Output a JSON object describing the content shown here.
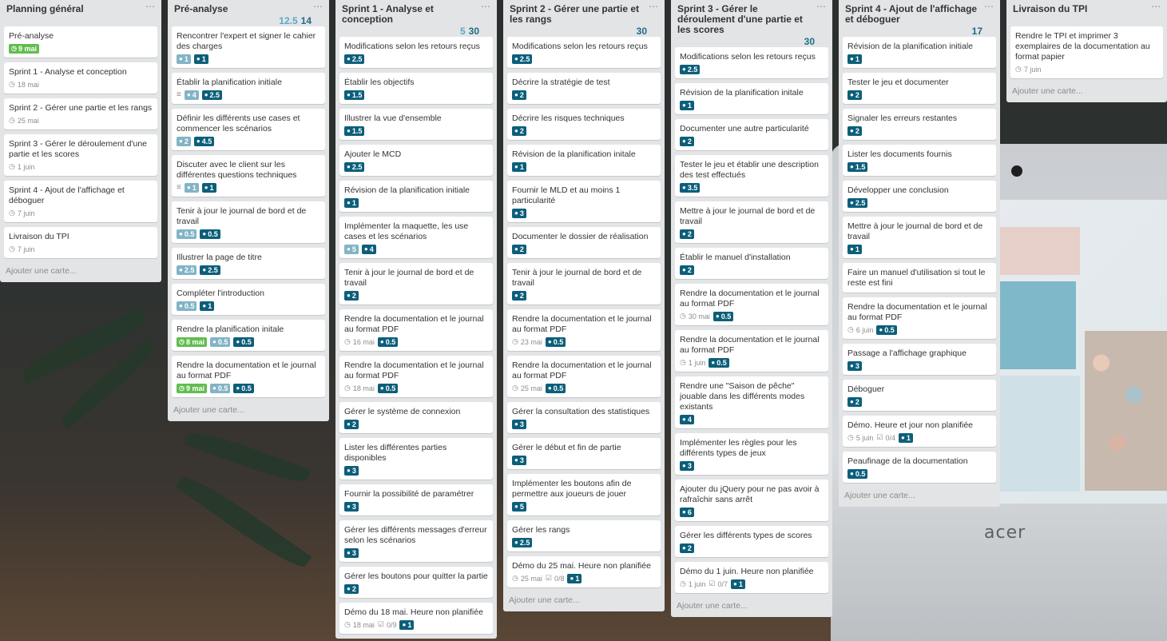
{
  "lists": [
    {
      "title": "Planning général",
      "points_a": "",
      "points_b": "",
      "add_card": "Ajouter une carte...",
      "cards": [
        {
          "title": "Pré-analyse",
          "date": "9 mai",
          "date_done": true,
          "badges": []
        },
        {
          "title": "Sprint 1 - Analyse et conception",
          "date": "18 mai",
          "badges": []
        },
        {
          "title": "Sprint 2 - Gérer une partie et les rangs",
          "date": "25 mai",
          "badges": []
        },
        {
          "title": "Sprint 3 - Gérer le déroulement d'une partie et les scores",
          "date": "1 juin",
          "badges": []
        },
        {
          "title": "Sprint 4 - Ajout de l'affichage et déboguer",
          "date": "7 juin",
          "badges": []
        },
        {
          "title": "Livraison du TPI",
          "date": "7 juin",
          "badges": []
        }
      ]
    },
    {
      "title": "Pré-analyse",
      "points_a": "12.5",
      "points_b": "14",
      "add_card": "Ajouter une carte...",
      "cards": [
        {
          "title": "Rencontrer l'expert et signer le cahier des charges",
          "badges": [
            {
              "t": "light",
              "v": "1"
            },
            {
              "t": "dark",
              "v": "1"
            }
          ]
        },
        {
          "title": "Établir la planification initiale",
          "desc": true,
          "badges": [
            {
              "t": "light",
              "v": "4"
            },
            {
              "t": "dark",
              "v": "2.5"
            }
          ]
        },
        {
          "title": "Définir les différents use cases et commencer les scénarios",
          "badges": [
            {
              "t": "light",
              "v": "2"
            },
            {
              "t": "dark",
              "v": "4.5"
            }
          ]
        },
        {
          "title": "Discuter avec le client sur les différentes questions techniques",
          "desc": true,
          "badges": [
            {
              "t": "light",
              "v": "1"
            },
            {
              "t": "dark",
              "v": "1"
            }
          ]
        },
        {
          "title": "Tenir à jour le journal de bord et de travail",
          "badges": [
            {
              "t": "light",
              "v": "0.5"
            },
            {
              "t": "dark",
              "v": "0.5"
            }
          ]
        },
        {
          "title": "Illustrer la page de titre",
          "badges": [
            {
              "t": "light",
              "v": "2.5"
            },
            {
              "t": "dark",
              "v": "2.5"
            }
          ]
        },
        {
          "title": "Compléter l'introduction",
          "badges": [
            {
              "t": "light",
              "v": "0.5"
            },
            {
              "t": "dark",
              "v": "1"
            }
          ]
        },
        {
          "title": "Rendre la planification initale",
          "date": "8 mai",
          "date_done": true,
          "badges": [
            {
              "t": "light",
              "v": "0.5"
            },
            {
              "t": "dark",
              "v": "0.5"
            }
          ]
        },
        {
          "title": "Rendre la documentation et le journal au format PDF",
          "date": "9 mai",
          "date_done": true,
          "badges": [
            {
              "t": "light",
              "v": "0.5"
            },
            {
              "t": "dark",
              "v": "0.5"
            }
          ]
        }
      ]
    },
    {
      "title": "Sprint 1 - Analyse et conception",
      "points_a": "5",
      "points_b": "30",
      "add_card": "",
      "cards": [
        {
          "title": "Modifications selon les retours reçus",
          "badges": [
            {
              "t": "dark",
              "v": "2.5"
            }
          ]
        },
        {
          "title": "Établir les objectifs",
          "badges": [
            {
              "t": "dark",
              "v": "1.5"
            }
          ]
        },
        {
          "title": "Illustrer la vue d'ensemble",
          "badges": [
            {
              "t": "dark",
              "v": "1.5"
            }
          ]
        },
        {
          "title": "Ajouter le MCD",
          "badges": [
            {
              "t": "dark",
              "v": "2.5"
            }
          ]
        },
        {
          "title": "Révision de la planification initiale",
          "badges": [
            {
              "t": "dark",
              "v": "1"
            }
          ]
        },
        {
          "title": "Implémenter la maquette, les use cases et les scénarios",
          "badges": [
            {
              "t": "light",
              "v": "5"
            },
            {
              "t": "dark",
              "v": "4"
            }
          ]
        },
        {
          "title": "Tenir à jour le journal de bord et de travail",
          "badges": [
            {
              "t": "dark",
              "v": "2"
            }
          ]
        },
        {
          "title": "Rendre la documentation et le journal au format PDF",
          "date": "16 mai",
          "badges": [
            {
              "t": "dark",
              "v": "0.5"
            }
          ]
        },
        {
          "title": "Rendre la documentation et le journal au format PDF",
          "date": "18 mai",
          "badges": [
            {
              "t": "dark",
              "v": "0.5"
            }
          ]
        },
        {
          "title": "Gérer le système de connexion",
          "badges": [
            {
              "t": "dark",
              "v": "2"
            }
          ]
        },
        {
          "title": "Lister les différentes parties disponibles",
          "badges": [
            {
              "t": "dark",
              "v": "3"
            }
          ]
        },
        {
          "title": "Fournir la possibilité de paramétrer",
          "badges": [
            {
              "t": "dark",
              "v": "3"
            }
          ]
        },
        {
          "title": "Gérer les différents messages d'erreur selon les scénarios",
          "badges": [
            {
              "t": "dark",
              "v": "3"
            }
          ]
        },
        {
          "title": "Gérer les boutons pour quitter la partie",
          "badges": [
            {
              "t": "dark",
              "v": "2"
            }
          ]
        },
        {
          "title": "Démo du 18 mai. Heure non planifiée",
          "date": "18 mai",
          "checklist": "0/9",
          "badges": [
            {
              "t": "dark",
              "v": "1"
            }
          ]
        }
      ]
    },
    {
      "title": "Sprint 2 - Gérer une partie et les rangs",
      "points_a": "",
      "points_b": "30",
      "add_card": "Ajouter une carte...",
      "cards": [
        {
          "title": "Modifications selon les retours reçus",
          "badges": [
            {
              "t": "dark",
              "v": "2.5"
            }
          ]
        },
        {
          "title": "Décrire la stratégie de test",
          "badges": [
            {
              "t": "dark",
              "v": "2"
            }
          ]
        },
        {
          "title": "Décrire les risques techniques",
          "badges": [
            {
              "t": "dark",
              "v": "2"
            }
          ]
        },
        {
          "title": "Révision de la planification initale",
          "badges": [
            {
              "t": "dark",
              "v": "1"
            }
          ]
        },
        {
          "title": "Fournir le MLD et au moins 1 particularité",
          "badges": [
            {
              "t": "dark",
              "v": "3"
            }
          ]
        },
        {
          "title": "Documenter le dossier de réalisation",
          "badges": [
            {
              "t": "dark",
              "v": "2"
            }
          ]
        },
        {
          "title": "Tenir à jour le journal de bord et de travail",
          "badges": [
            {
              "t": "dark",
              "v": "2"
            }
          ]
        },
        {
          "title": "Rendre la documentation et le journal au format PDF",
          "date": "23 mai",
          "badges": [
            {
              "t": "dark",
              "v": "0.5"
            }
          ]
        },
        {
          "title": "Rendre la documentation et le journal au format PDF",
          "date": "25 mai",
          "badges": [
            {
              "t": "dark",
              "v": "0.5"
            }
          ]
        },
        {
          "title": "Gérer la consultation des statistiques",
          "badges": [
            {
              "t": "dark",
              "v": "3"
            }
          ]
        },
        {
          "title": "Gérer le début et fin de partie",
          "badges": [
            {
              "t": "dark",
              "v": "3"
            }
          ]
        },
        {
          "title": "Implémenter les boutons afin de permettre aux joueurs de jouer",
          "badges": [
            {
              "t": "dark",
              "v": "5"
            }
          ]
        },
        {
          "title": "Gérer les rangs",
          "badges": [
            {
              "t": "dark",
              "v": "2.5"
            }
          ]
        },
        {
          "title": "Démo du 25 mai. Heure non planifiée",
          "date": "25 mai",
          "checklist": "0/8",
          "badges": [
            {
              "t": "dark",
              "v": "1"
            }
          ]
        }
      ]
    },
    {
      "title": "Sprint 3 - Gérer le déroulement d'une partie et les scores",
      "points_a": "",
      "points_b": "30",
      "add_card": "Ajouter une carte...",
      "cards": [
        {
          "title": "Modifications selon les retours reçus",
          "badges": [
            {
              "t": "dark",
              "v": "2.5"
            }
          ]
        },
        {
          "title": "Révision de la planification initale",
          "badges": [
            {
              "t": "dark",
              "v": "1"
            }
          ]
        },
        {
          "title": "Documenter une autre particularité",
          "badges": [
            {
              "t": "dark",
              "v": "2"
            }
          ]
        },
        {
          "title": "Tester le jeu et établir une description des test effectués",
          "badges": [
            {
              "t": "dark",
              "v": "3.5"
            }
          ]
        },
        {
          "title": "Mettre à jour le journal de bord et de travail",
          "badges": [
            {
              "t": "dark",
              "v": "2"
            }
          ]
        },
        {
          "title": "Établir le manuel d'installation",
          "badges": [
            {
              "t": "dark",
              "v": "2"
            }
          ]
        },
        {
          "title": "Rendre la documentation et le journal au format PDF",
          "date": "30 mai",
          "badges": [
            {
              "t": "dark",
              "v": "0.5"
            }
          ]
        },
        {
          "title": "Rendre la documentation et le journal au format PDF",
          "date": "1 juin",
          "badges": [
            {
              "t": "dark",
              "v": "0.5"
            }
          ]
        },
        {
          "title": "Rendre une \"Saison de pêche\" jouable dans les différents modes existants",
          "badges": [
            {
              "t": "dark",
              "v": "4"
            }
          ]
        },
        {
          "title": "Implémenter les règles pour les différents types de jeux",
          "badges": [
            {
              "t": "dark",
              "v": "3"
            }
          ]
        },
        {
          "title": "Ajouter du jQuery pour ne pas avoir à rafraîchir sans arrêt",
          "badges": [
            {
              "t": "dark",
              "v": "6"
            }
          ]
        },
        {
          "title": "Gérer les différents types de scores",
          "badges": [
            {
              "t": "dark",
              "v": "2"
            }
          ]
        },
        {
          "title": "Démo du 1 juin. Heure non planifiée",
          "date": "1 juin",
          "checklist": "0/7",
          "badges": [
            {
              "t": "dark",
              "v": "1"
            }
          ]
        }
      ]
    },
    {
      "title": "Sprint 4 - Ajout de l'affichage et déboguer",
      "points_a": "",
      "points_b": "17",
      "add_card": "Ajouter une carte...",
      "cards": [
        {
          "title": "Révision de la planification initiale",
          "badges": [
            {
              "t": "dark",
              "v": "1"
            }
          ]
        },
        {
          "title": "Tester le jeu et documenter",
          "badges": [
            {
              "t": "dark",
              "v": "2"
            }
          ]
        },
        {
          "title": "Signaler les erreurs restantes",
          "badges": [
            {
              "t": "dark",
              "v": "2"
            }
          ]
        },
        {
          "title": "Lister les documents fournis",
          "badges": [
            {
              "t": "dark",
              "v": "1.5"
            }
          ]
        },
        {
          "title": "Développer une conclusion",
          "badges": [
            {
              "t": "dark",
              "v": "2.5"
            }
          ]
        },
        {
          "title": "Mettre à jour le journal de bord et de travail",
          "badges": [
            {
              "t": "dark",
              "v": "1"
            }
          ]
        },
        {
          "title": "Faire un manuel d'utilisation si tout le reste est fini",
          "badges": []
        },
        {
          "title": "Rendre la documentation et le journal au format PDF",
          "date": "6 juin",
          "badges": [
            {
              "t": "dark",
              "v": "0.5"
            }
          ]
        },
        {
          "title": "Passage a l'affichage graphique",
          "badges": [
            {
              "t": "dark",
              "v": "3"
            }
          ]
        },
        {
          "title": "Déboguer",
          "badges": [
            {
              "t": "dark",
              "v": "2"
            }
          ]
        },
        {
          "title": "Démo. Heure et jour non planifiée",
          "date": "5 juin",
          "checklist": "0/4",
          "badges": [
            {
              "t": "dark",
              "v": "1"
            }
          ]
        },
        {
          "title": "Peaufinage de la documentation",
          "badges": [
            {
              "t": "dark",
              "v": "0.5"
            }
          ]
        }
      ]
    },
    {
      "title": "Livraison du TPI",
      "points_a": "",
      "points_b": "",
      "add_card": "Ajouter une carte...",
      "cards": [
        {
          "title": "Rendre le TPI et imprimer 3 exemplaires de la documentation au format papier",
          "date": "7 juin",
          "badges": []
        }
      ]
    }
  ],
  "icons": {
    "clock": "clock-icon",
    "description": "description-icon",
    "checklist": "checklist-icon",
    "points": "points-icon",
    "menu": "list-menu-icon"
  },
  "colors": {
    "list_bg": "#e2e4e6",
    "badge_dark": "#0c5f7a",
    "badge_light": "#82b4c6",
    "badge_done": "#61bd4f"
  }
}
